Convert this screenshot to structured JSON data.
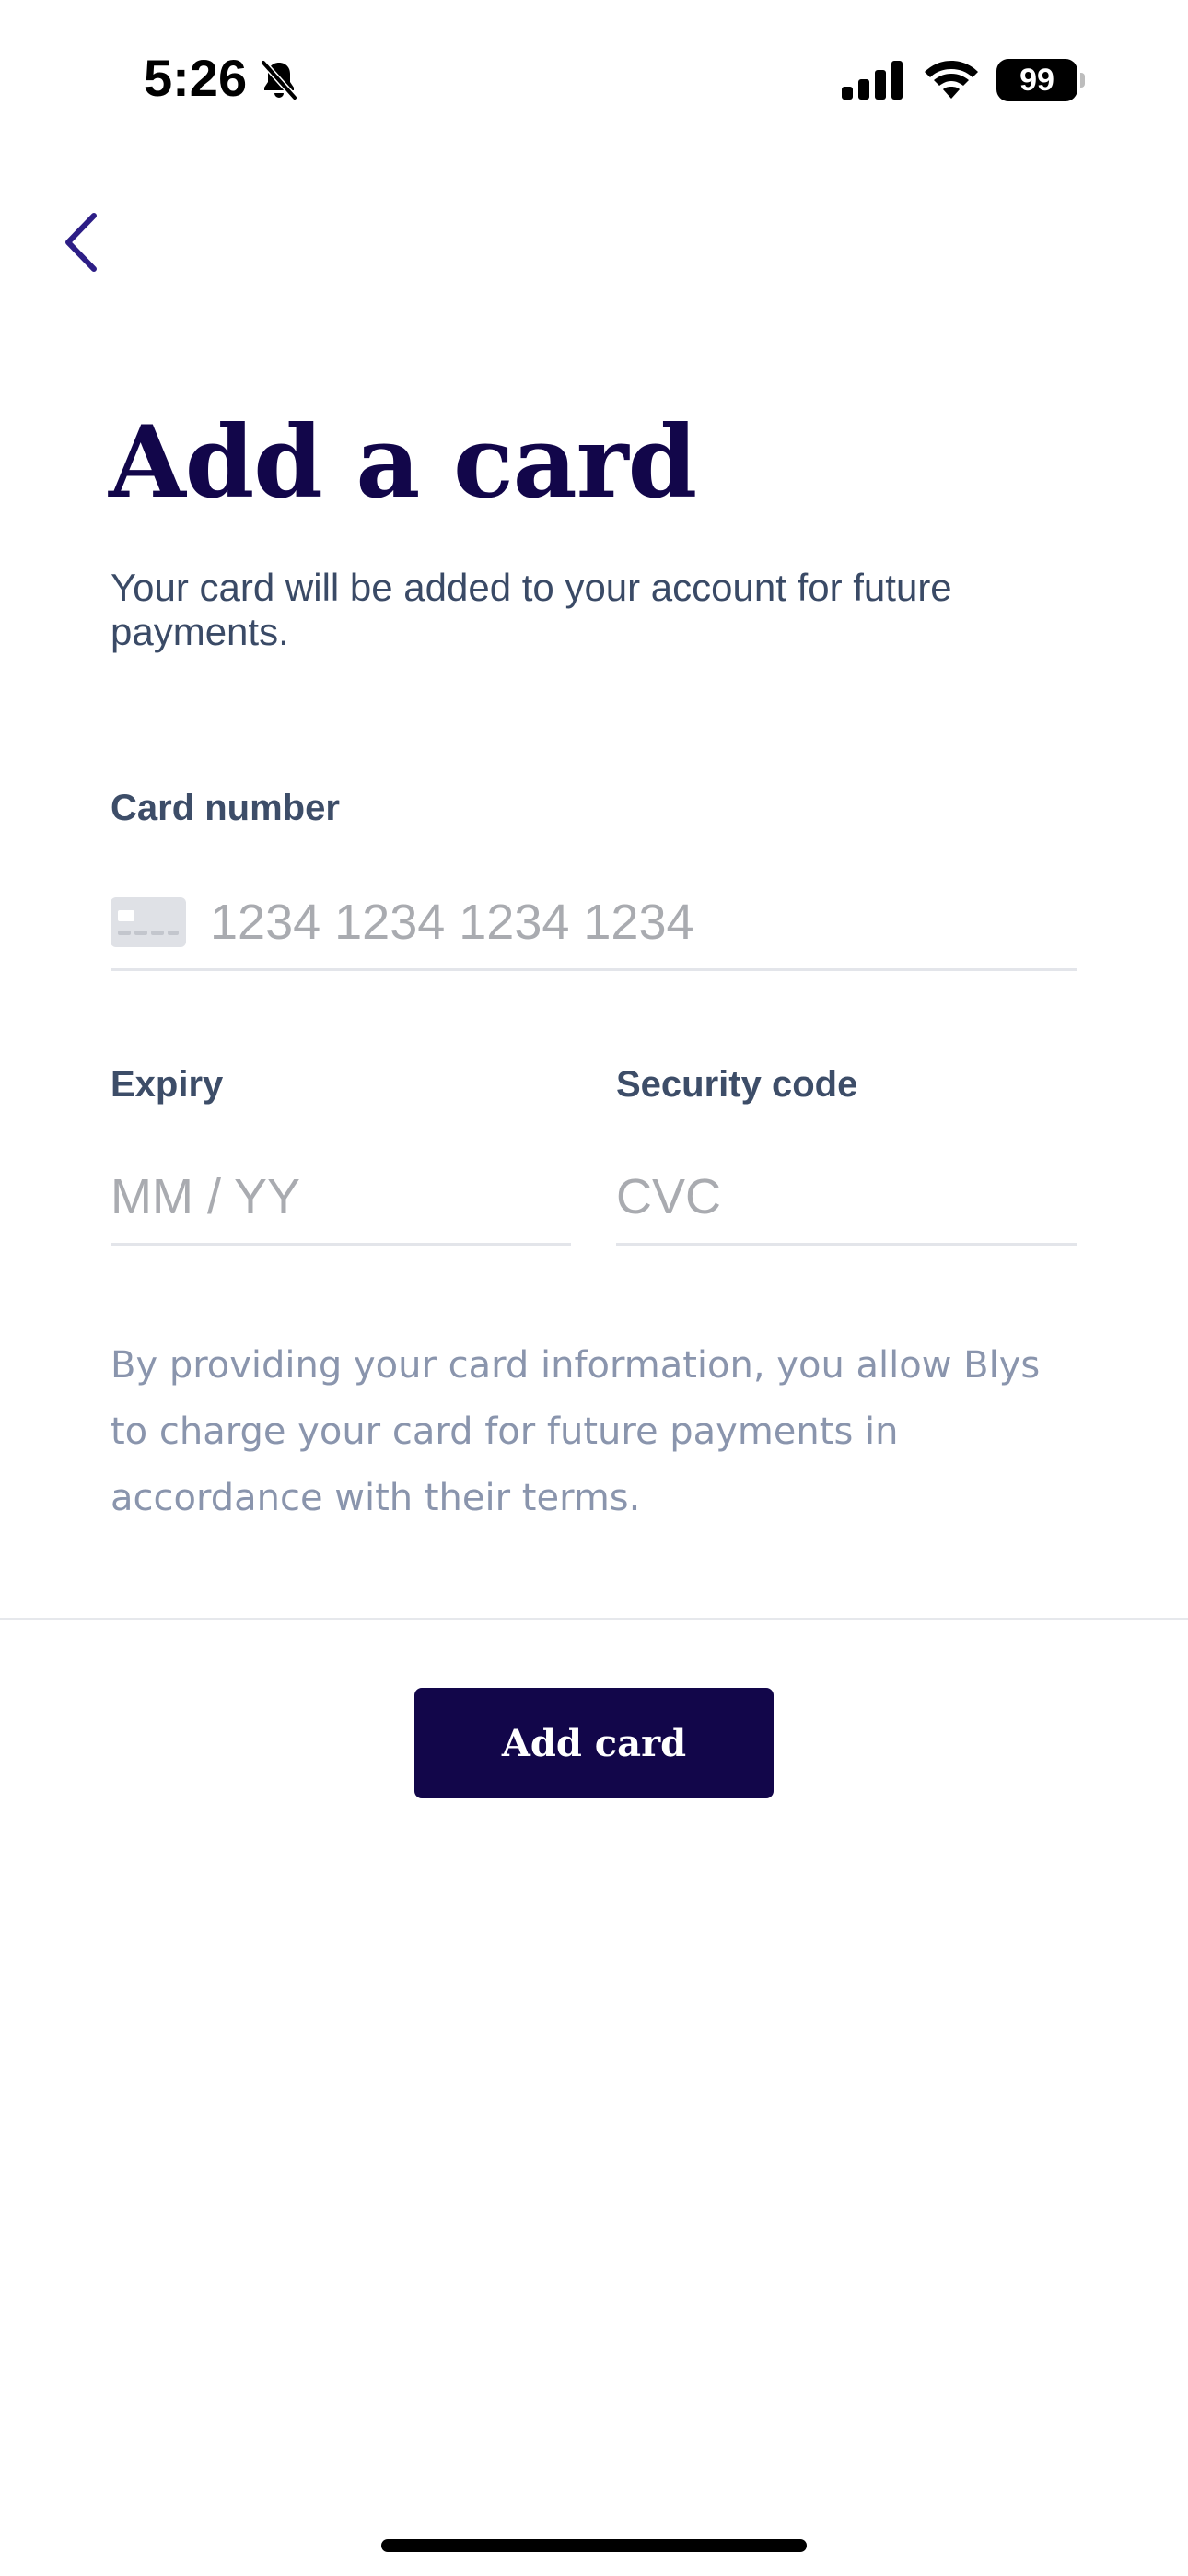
{
  "status_bar": {
    "time": "5:26",
    "battery": "99",
    "icons": [
      "bell-slash-icon",
      "cellular-signal-icon",
      "wifi-icon",
      "battery-icon"
    ]
  },
  "nav": {
    "back_icon": "chevron-left-icon"
  },
  "header": {
    "title": "Add a card",
    "subtitle": "Your card will be added to your account for future payments."
  },
  "form": {
    "card_number": {
      "label": "Card number",
      "placeholder": "1234 1234 1234 1234",
      "value": "",
      "icon": "credit-card-icon"
    },
    "expiry": {
      "label": "Expiry",
      "placeholder": "MM / YY",
      "value": ""
    },
    "security_code": {
      "label": "Security code",
      "placeholder": "CVC",
      "value": ""
    },
    "consent": "By providing your card information, you allow Blys to charge your card for future payments in accordance with their terms."
  },
  "actions": {
    "submit_label": "Add card"
  },
  "colors": {
    "brand": "#12064a",
    "back_icon": "#2d1e86",
    "label": "#3d4d68",
    "consent": "#8a95ad",
    "placeholder": "#a9abb0"
  }
}
